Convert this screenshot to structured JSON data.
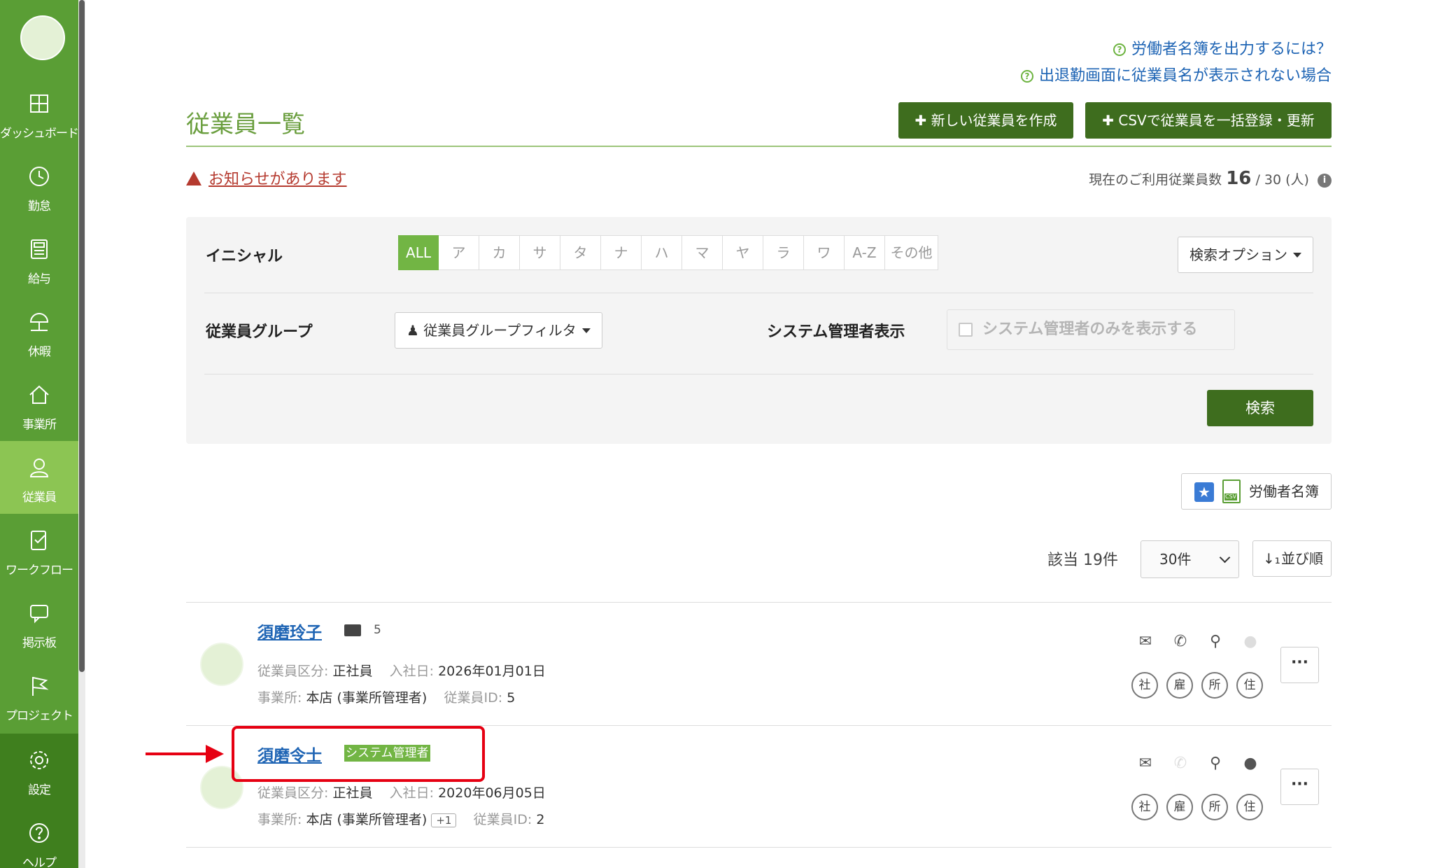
{
  "sidebar": {
    "items": [
      {
        "label": "ダッシュボード"
      },
      {
        "label": "勤怠"
      },
      {
        "label": "給与"
      },
      {
        "label": "休暇"
      },
      {
        "label": "事業所"
      },
      {
        "label": "従業員"
      },
      {
        "label": "ワークフロー"
      },
      {
        "label": "掲示板"
      },
      {
        "label": "プロジェクト"
      },
      {
        "label": "設定"
      },
      {
        "label": "ヘルプ"
      }
    ]
  },
  "help_links": [
    "労働者名簿を出力するには？",
    "出退勤画面に従業員名が表示されない場合"
  ],
  "header": {
    "title": "従業員一覧",
    "new_button": "新しい従業員を作成",
    "csv_button": "CSVで従業員を一括登録・更新"
  },
  "notice": "お知らせがあります",
  "usage": {
    "label": "現在のご利用従業員数",
    "current": "16",
    "separator": "/",
    "limit": "30 (人)"
  },
  "filter": {
    "initial_label": "イニシャル",
    "initials": [
      "ALL",
      "ア",
      "カ",
      "サ",
      "タ",
      "ナ",
      "ハ",
      "マ",
      "ヤ",
      "ラ",
      "ワ",
      "A-Z",
      "その他"
    ],
    "search_options": "検索オプション",
    "group_label": "従業員グループ",
    "group_filter": "従業員グループフィルタ",
    "admin_label": "システム管理者表示",
    "admin_checkbox": "システム管理者のみを表示する",
    "search_button": "検索"
  },
  "roster_button": "労働者名簿",
  "csv_badge": "CSV",
  "results": {
    "count_label": "該当 19件",
    "per_page": "30件",
    "sort_label": "並び順"
  },
  "labels": {
    "type": "従業員区分:",
    "hire_date": "入社日:",
    "office": "事業所:",
    "employee_id": "従業員ID:"
  },
  "employees": [
    {
      "name": "須磨玲子",
      "card_number": "5",
      "type": "正社員",
      "hire_date": "2026年01月01日",
      "office": "本店 (事業所管理者)",
      "employee_id": "5"
    },
    {
      "name": "須磨令士",
      "badge": "システム管理者",
      "type": "正社員",
      "hire_date": "2020年06月05日",
      "office": "本店 (事業所管理者)",
      "office_extra": "+1",
      "employee_id": "2"
    }
  ],
  "circle_labels": [
    "社",
    "雇",
    "所",
    "住"
  ],
  "colors": {
    "accent": "#5a9e35",
    "dark_button": "#3e6d1e",
    "link": "#1e64b4",
    "alert": "#b53a2f",
    "annotation": "#e60012"
  }
}
